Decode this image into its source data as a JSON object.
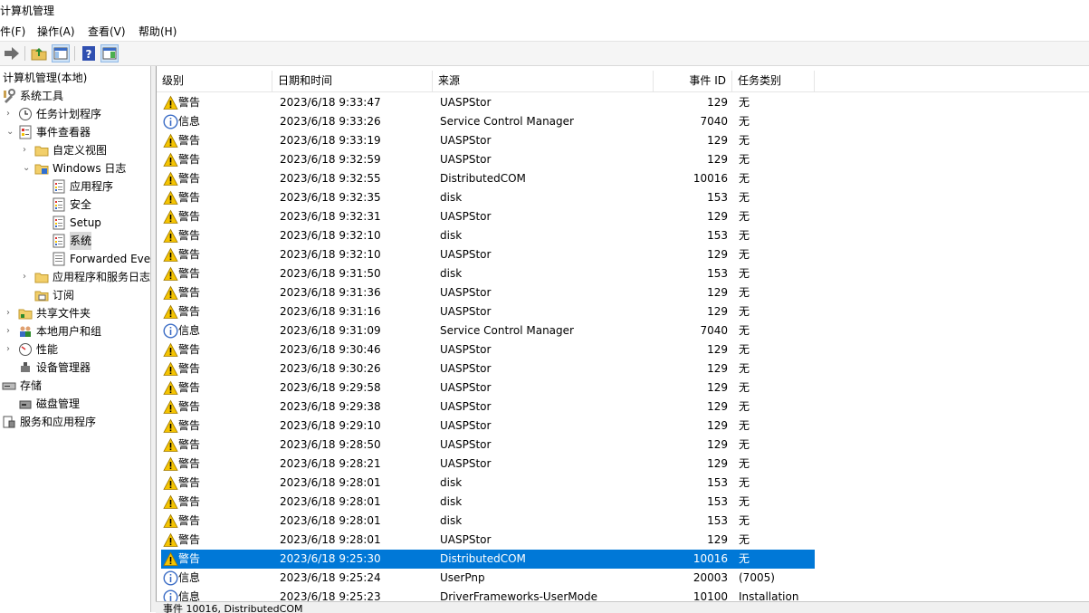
{
  "window": {
    "title": "计算机管理"
  },
  "menu": [
    "件(F)",
    "操作(A)",
    "查看(V)",
    "帮助(H)"
  ],
  "toolbar": [
    "forward-arrow-icon",
    "up-folder-icon",
    "show-hide-tree-icon",
    "help-icon",
    "properties-icon"
  ],
  "tree": [
    {
      "label": "计算机管理(本地)",
      "icon": "computer-management-icon",
      "level": 0,
      "arrow": "",
      "selected": false
    },
    {
      "label": "系统工具",
      "icon": "system-tools-icon",
      "level": 0,
      "arrow": "",
      "selected": false
    },
    {
      "label": "任务计划程序",
      "icon": "clock-icon",
      "level": 1,
      "arrow": "collapsed",
      "selected": false
    },
    {
      "label": "事件查看器",
      "icon": "event-viewer-icon",
      "level": 1,
      "arrow": "expanded",
      "selected": false
    },
    {
      "label": "自定义视图",
      "icon": "folder-icon",
      "level": 2,
      "arrow": "collapsed",
      "selected": false
    },
    {
      "label": "Windows 日志",
      "icon": "windows-logs-icon",
      "level": 2,
      "arrow": "expanded",
      "selected": false
    },
    {
      "label": "应用程序",
      "icon": "log-icon",
      "level": 3,
      "arrow": "",
      "selected": false
    },
    {
      "label": "安全",
      "icon": "log-icon",
      "level": 3,
      "arrow": "",
      "selected": false
    },
    {
      "label": "Setup",
      "icon": "log-icon",
      "level": 3,
      "arrow": "",
      "selected": false
    },
    {
      "label": "系统",
      "icon": "log-icon",
      "level": 3,
      "arrow": "",
      "selected": true
    },
    {
      "label": "Forwarded Eve",
      "icon": "forwarded-log-icon",
      "level": 3,
      "arrow": "",
      "selected": false
    },
    {
      "label": "应用程序和服务日志",
      "icon": "folder-icon",
      "level": 2,
      "arrow": "collapsed",
      "selected": false
    },
    {
      "label": "订阅",
      "icon": "subscription-icon",
      "level": 2,
      "arrow": "",
      "selected": false
    },
    {
      "label": "共享文件夹",
      "icon": "shared-folder-icon",
      "level": 1,
      "arrow": "collapsed",
      "selected": false
    },
    {
      "label": "本地用户和组",
      "icon": "users-icon",
      "level": 1,
      "arrow": "collapsed",
      "selected": false
    },
    {
      "label": "性能",
      "icon": "performance-icon",
      "level": 1,
      "arrow": "collapsed",
      "selected": false
    },
    {
      "label": "设备管理器",
      "icon": "device-manager-icon",
      "level": 1,
      "arrow": "",
      "selected": false
    },
    {
      "label": "存储",
      "icon": "storage-icon",
      "level": 0,
      "arrow": "",
      "selected": false
    },
    {
      "label": "磁盘管理",
      "icon": "disk-management-icon",
      "level": 1,
      "arrow": "",
      "selected": false
    },
    {
      "label": "服务和应用程序",
      "icon": "services-icon",
      "level": 0,
      "arrow": "",
      "selected": false
    }
  ],
  "columns": [
    "级别",
    "日期和时间",
    "来源",
    "事件 ID",
    "任务类别"
  ],
  "events": [
    {
      "level": "警告",
      "icon": "warning-icon",
      "datetime": "2023/6/18 9:33:47",
      "source": "UASPStor",
      "id": "129",
      "category": "无"
    },
    {
      "level": "信息",
      "icon": "info-icon",
      "datetime": "2023/6/18 9:33:26",
      "source": "Service Control Manager",
      "id": "7040",
      "category": "无"
    },
    {
      "level": "警告",
      "icon": "warning-icon",
      "datetime": "2023/6/18 9:33:19",
      "source": "UASPStor",
      "id": "129",
      "category": "无"
    },
    {
      "level": "警告",
      "icon": "warning-icon",
      "datetime": "2023/6/18 9:32:59",
      "source": "UASPStor",
      "id": "129",
      "category": "无"
    },
    {
      "level": "警告",
      "icon": "warning-icon",
      "datetime": "2023/6/18 9:32:55",
      "source": "DistributedCOM",
      "id": "10016",
      "category": "无"
    },
    {
      "level": "警告",
      "icon": "warning-icon",
      "datetime": "2023/6/18 9:32:35",
      "source": "disk",
      "id": "153",
      "category": "无"
    },
    {
      "level": "警告",
      "icon": "warning-icon",
      "datetime": "2023/6/18 9:32:31",
      "source": "UASPStor",
      "id": "129",
      "category": "无"
    },
    {
      "level": "警告",
      "icon": "warning-icon",
      "datetime": "2023/6/18 9:32:10",
      "source": "disk",
      "id": "153",
      "category": "无"
    },
    {
      "level": "警告",
      "icon": "warning-icon",
      "datetime": "2023/6/18 9:32:10",
      "source": "UASPStor",
      "id": "129",
      "category": "无"
    },
    {
      "level": "警告",
      "icon": "warning-icon",
      "datetime": "2023/6/18 9:31:50",
      "source": "disk",
      "id": "153",
      "category": "无"
    },
    {
      "level": "警告",
      "icon": "warning-icon",
      "datetime": "2023/6/18 9:31:36",
      "source": "UASPStor",
      "id": "129",
      "category": "无"
    },
    {
      "level": "警告",
      "icon": "warning-icon",
      "datetime": "2023/6/18 9:31:16",
      "source": "UASPStor",
      "id": "129",
      "category": "无"
    },
    {
      "level": "信息",
      "icon": "info-icon",
      "datetime": "2023/6/18 9:31:09",
      "source": "Service Control Manager",
      "id": "7040",
      "category": "无"
    },
    {
      "level": "警告",
      "icon": "warning-icon",
      "datetime": "2023/6/18 9:30:46",
      "source": "UASPStor",
      "id": "129",
      "category": "无"
    },
    {
      "level": "警告",
      "icon": "warning-icon",
      "datetime": "2023/6/18 9:30:26",
      "source": "UASPStor",
      "id": "129",
      "category": "无"
    },
    {
      "level": "警告",
      "icon": "warning-icon",
      "datetime": "2023/6/18 9:29:58",
      "source": "UASPStor",
      "id": "129",
      "category": "无"
    },
    {
      "level": "警告",
      "icon": "warning-icon",
      "datetime": "2023/6/18 9:29:38",
      "source": "UASPStor",
      "id": "129",
      "category": "无"
    },
    {
      "level": "警告",
      "icon": "warning-icon",
      "datetime": "2023/6/18 9:29:10",
      "source": "UASPStor",
      "id": "129",
      "category": "无"
    },
    {
      "level": "警告",
      "icon": "warning-icon",
      "datetime": "2023/6/18 9:28:50",
      "source": "UASPStor",
      "id": "129",
      "category": "无"
    },
    {
      "level": "警告",
      "icon": "warning-icon",
      "datetime": "2023/6/18 9:28:21",
      "source": "UASPStor",
      "id": "129",
      "category": "无"
    },
    {
      "level": "警告",
      "icon": "warning-icon",
      "datetime": "2023/6/18 9:28:01",
      "source": "disk",
      "id": "153",
      "category": "无"
    },
    {
      "level": "警告",
      "icon": "warning-icon",
      "datetime": "2023/6/18 9:28:01",
      "source": "disk",
      "id": "153",
      "category": "无"
    },
    {
      "level": "警告",
      "icon": "warning-icon",
      "datetime": "2023/6/18 9:28:01",
      "source": "disk",
      "id": "153",
      "category": "无"
    },
    {
      "level": "警告",
      "icon": "warning-icon",
      "datetime": "2023/6/18 9:28:01",
      "source": "UASPStor",
      "id": "129",
      "category": "无"
    },
    {
      "level": "警告",
      "icon": "warning-icon",
      "datetime": "2023/6/18 9:25:30",
      "source": "DistributedCOM",
      "id": "10016",
      "category": "无",
      "selected": true
    },
    {
      "level": "信息",
      "icon": "info-icon",
      "datetime": "2023/6/18 9:25:24",
      "source": "UserPnp",
      "id": "20003",
      "category": "(7005)"
    },
    {
      "level": "信息",
      "icon": "info-icon",
      "datetime": "2023/6/18 9:25:23",
      "source": "DriverFrameworks-UserMode",
      "id": "10100",
      "category": "Installation"
    }
  ],
  "details_header": "事件 10016, DistributedCOM",
  "colors": {
    "selection": "#0078d7",
    "warning": "#f5c400",
    "info": "#3a6cc5"
  }
}
